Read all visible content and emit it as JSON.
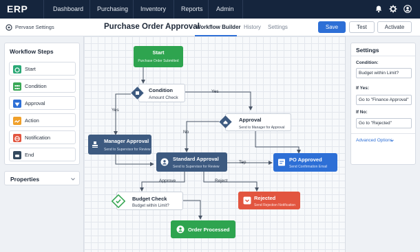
{
  "app": {
    "brand": "ERP"
  },
  "topnav": {
    "items": [
      "Dashboard",
      "Purchasing",
      "Inventory",
      "Reports",
      "Admin"
    ],
    "icons": [
      "bell-icon",
      "gear-icon",
      "user-icon"
    ]
  },
  "subheader": {
    "preview_label": "Pervase Settings",
    "title": "Purchase Order Approval",
    "tabs": [
      "Workflow Builder",
      "History",
      "Settings"
    ],
    "active_tab": "Workflow Builder",
    "buttons": {
      "save": "Save",
      "test": "Test",
      "activate": "Activate"
    }
  },
  "workflow_steps": {
    "title": "Workflow Steps",
    "items": [
      {
        "label": "Start",
        "icon": "start-icon",
        "color": "#2aa876"
      },
      {
        "label": "Condition",
        "icon": "condition-icon",
        "color": "#3aa856"
      },
      {
        "label": "Approval",
        "icon": "approval-icon",
        "color": "#2d6fd6"
      },
      {
        "label": "Action",
        "icon": "action-icon",
        "color": "#f0a02a"
      },
      {
        "label": "Notification",
        "icon": "notification-icon",
        "color": "#e2553f"
      },
      {
        "label": "End",
        "icon": "end-icon",
        "color": "#34495e"
      }
    ]
  },
  "properties": {
    "title": "Properties"
  },
  "settings": {
    "title": "Settings",
    "condition_label": "Condition:",
    "condition_value": "Budget within Limit?",
    "if_yes_label": "If Yes:",
    "if_yes_value": "Go to \"Finance Approval\"",
    "if_no_label": "If No:",
    "if_no_value": "Go to \"Rejected\"",
    "advanced": "Advanced Options"
  },
  "flow": {
    "nodes": {
      "start": {
        "title": "Start",
        "sub": "Purchase Order Submitted",
        "color": "#2ea44f"
      },
      "condition": {
        "title": "Condition",
        "sub": "Amount Check"
      },
      "approval": {
        "title": "Approval",
        "sub": "Send to Manager for Approval"
      },
      "manager": {
        "title": "Manager Approval",
        "sub": "Send to Supervisor for Review",
        "color": "#3d5a80"
      },
      "standard": {
        "title": "Standard Approval",
        "sub": "Send to Supervisor for Review",
        "color": "#3d5a80"
      },
      "po_approved": {
        "title": "PO Approved",
        "sub": "Send Confirmation Email",
        "color": "#2d6fd6"
      },
      "budget": {
        "title": "Budget Check",
        "sub": "Budget within Limit?"
      },
      "rejected": {
        "title": "Rejected",
        "sub": "Send Rejection Notification",
        "color": "#e2553f"
      },
      "processed": {
        "title": "Order Processed",
        "color": "#2ea44f"
      }
    },
    "edge_labels": {
      "yes_top": "Yes",
      "yes_left": "Yes",
      "no": "No",
      "tep": "Tep",
      "approve": "Approve",
      "reject": "Reject"
    }
  }
}
